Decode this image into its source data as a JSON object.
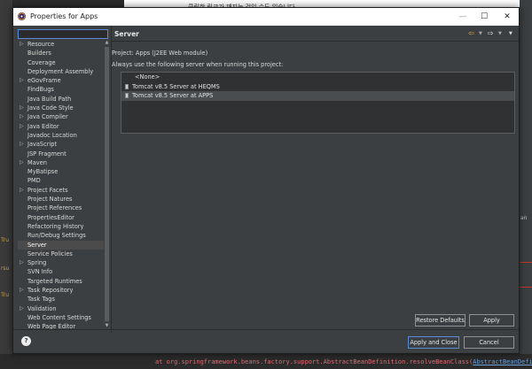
{
  "background": {
    "top_text": "클릭한 링크가 깨지는 것일 수도 있습니다.",
    "stack_prefix": "at org.springframework.beans.factory.support.AbstractBeanDefinition.resolveBeanClass(",
    "stack_link": "AbstractBeanDefinition",
    "side_fragments": [
      "Tru",
      "rsu",
      "Tru"
    ],
    "right_fragment": "an"
  },
  "dialog": {
    "title": "Properties for Apps",
    "window_buttons": {
      "minimize": "—",
      "maximize": "☐",
      "close": "✕"
    },
    "filter": {
      "value": "",
      "placeholder": ""
    },
    "tree": [
      {
        "label": "Resource",
        "expandable": true
      },
      {
        "label": "Builders",
        "expandable": false
      },
      {
        "label": "Coverage",
        "expandable": false
      },
      {
        "label": "Deployment Assembly",
        "expandable": false
      },
      {
        "label": "eGovFrame",
        "expandable": true
      },
      {
        "label": "FindBugs",
        "expandable": false
      },
      {
        "label": "Java Build Path",
        "expandable": false
      },
      {
        "label": "Java Code Style",
        "expandable": true
      },
      {
        "label": "Java Compiler",
        "expandable": true
      },
      {
        "label": "Java Editor",
        "expandable": true
      },
      {
        "label": "Javadoc Location",
        "expandable": false
      },
      {
        "label": "JavaScript",
        "expandable": true
      },
      {
        "label": "JSP Fragment",
        "expandable": false
      },
      {
        "label": "Maven",
        "expandable": true
      },
      {
        "label": "MyBatipse",
        "expandable": false
      },
      {
        "label": "PMD",
        "expandable": false
      },
      {
        "label": "Project Facets",
        "expandable": true
      },
      {
        "label": "Project Natures",
        "expandable": false
      },
      {
        "label": "Project References",
        "expandable": false
      },
      {
        "label": "PropertiesEditor",
        "expandable": false
      },
      {
        "label": "Refactoring History",
        "expandable": false
      },
      {
        "label": "Run/Debug Settings",
        "expandable": false
      },
      {
        "label": "Server",
        "expandable": false,
        "selected": true
      },
      {
        "label": "Service Policies",
        "expandable": false
      },
      {
        "label": "Spring",
        "expandable": true
      },
      {
        "label": "SVN Info",
        "expandable": false
      },
      {
        "label": "Targeted Runtimes",
        "expandable": false
      },
      {
        "label": "Task Repository",
        "expandable": true
      },
      {
        "label": "Task Tags",
        "expandable": false
      },
      {
        "label": "Validation",
        "expandable": true
      },
      {
        "label": "Web Content Settings",
        "expandable": false
      },
      {
        "label": "Web Page Editor",
        "expandable": false
      }
    ],
    "page": {
      "title": "Server",
      "project_line": "Project: Apps (J2EE Web module)",
      "instruction": "Always use the following server when running this project:",
      "servers": [
        {
          "label": "<None>",
          "icon": false,
          "selected": false
        },
        {
          "label": "Tomcat v8.5 Server at HEQMS",
          "icon": true,
          "selected": false
        },
        {
          "label": "Tomcat v8.5 Server at APPS",
          "icon": true,
          "selected": true
        }
      ],
      "restore_defaults": "Restore Defaults",
      "apply": "Apply"
    },
    "footer": {
      "help": "?",
      "apply_and_close": "Apply and Close",
      "cancel": "Cancel"
    },
    "colors": {
      "dialog_bg": "#3c3f41",
      "titlebar_bg": "#ffffff",
      "selection": "#4b4b4b",
      "focus_border": "#5b8ad6",
      "nav_back_arrow": "#e8b44a",
      "stack_error": "#e06c75"
    }
  }
}
